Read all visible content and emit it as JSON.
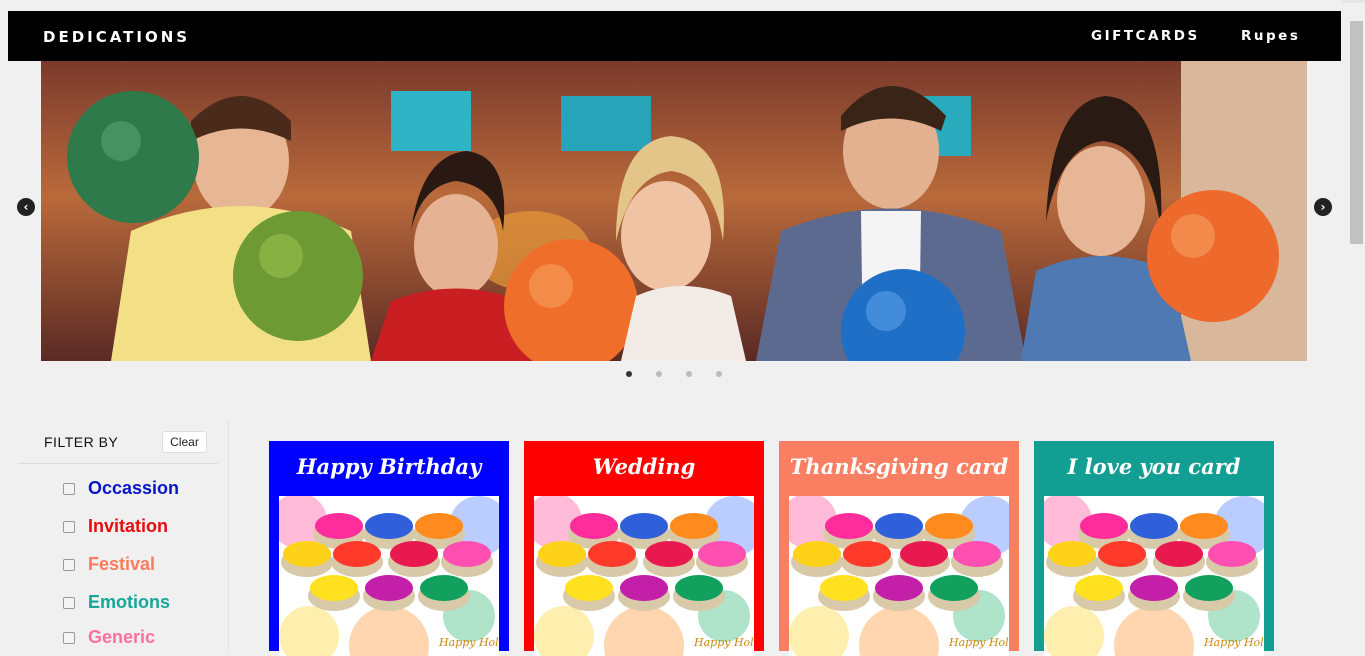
{
  "navbar": {
    "brand": "DEDICATIONS",
    "links": [
      "GIFTCARDS",
      "Rupes"
    ]
  },
  "carousel": {
    "prev_icon": "chevron-left-icon",
    "next_icon": "chevron-right-icon",
    "slide_count": 4,
    "active_slide": 1
  },
  "sidebar": {
    "title": "FILTER BY",
    "clear_label": "Clear",
    "filters": [
      {
        "label": "Occassion",
        "color": "#0a14c8"
      },
      {
        "label": "Invitation",
        "color": "#e60d0d"
      },
      {
        "label": "Festival",
        "color": "#ff7b5c"
      },
      {
        "label": "Emotions",
        "color": "#14a79a"
      },
      {
        "label": "Generic",
        "color": "#ff6fa0"
      }
    ]
  },
  "cards": [
    {
      "title": "Happy Birthday",
      "color": "#0000ff"
    },
    {
      "title": "Wedding",
      "color": "#ff0000"
    },
    {
      "title": "Thanksgiving card",
      "color": "#fa7f62"
    },
    {
      "title": "I love you card",
      "color": "#139e93"
    }
  ],
  "card_image_caption": "Happy Holi"
}
